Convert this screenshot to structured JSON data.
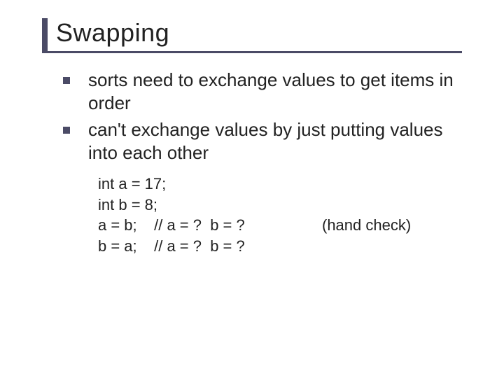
{
  "title": "Swapping",
  "bullets": [
    "sorts need to exchange values to get items in order",
    "can't exchange values by just putting values into each other"
  ],
  "code": {
    "lines": [
      {
        "left": "int a = 17;",
        "right": ""
      },
      {
        "left": "int b = 8;",
        "right": ""
      },
      {
        "left": "a = b;    // a = ?  b = ?",
        "right": "(hand check)"
      },
      {
        "left": "b = a;    // a = ?  b = ?",
        "right": ""
      }
    ]
  }
}
